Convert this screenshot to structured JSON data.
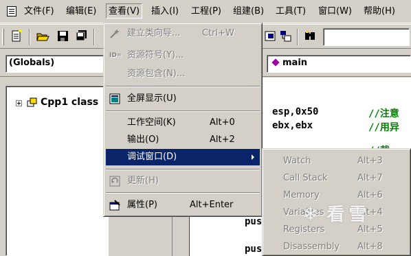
{
  "menubar": {
    "items": [
      {
        "label": "文件(F)"
      },
      {
        "label": "编辑(E)"
      },
      {
        "label": "查看(V)"
      },
      {
        "label": "插入(I)"
      },
      {
        "label": "工程(P)"
      },
      {
        "label": "组建(B)"
      },
      {
        "label": "工具(T)"
      },
      {
        "label": "窗口(W)"
      },
      {
        "label": "帮助(H)"
      }
    ]
  },
  "wizard": {
    "scope": "(Globals)",
    "function": "main"
  },
  "workspace": {
    "tree_root": "Cpp1 class"
  },
  "editor": {
    "lines": [
      {
        "code": "esp,0x50",
        "comment": "//注意"
      },
      {
        "code": "ebx,ebx",
        "comment": "//用异"
      },
      {
        "code": "",
        "comment": "//截"
      },
      {
        "code": "pus",
        "comment": ""
      },
      {
        "code": "pus",
        "comment": ""
      }
    ]
  },
  "view_menu": {
    "items": [
      {
        "label": "建立类向导...",
        "accel": "Ctrl+W",
        "disabled": true,
        "icon": "class-wizard-icon"
      },
      {
        "label": "资源符号(Y)...",
        "accel": "",
        "disabled": true,
        "icon": "resource-symbols-icon"
      },
      {
        "label": "资源包含(N)...",
        "accel": "",
        "disabled": true,
        "icon": ""
      },
      {
        "label": "全屏显示(U)",
        "accel": "",
        "disabled": false,
        "icon": "full-screen-icon"
      },
      {
        "label": "工作空间(K)",
        "accel": "Alt+0",
        "disabled": false,
        "icon": ""
      },
      {
        "label": "输出(O)",
        "accel": "Alt+2",
        "disabled": false,
        "icon": ""
      },
      {
        "label": "调试窗口(D)",
        "accel": "",
        "disabled": false,
        "icon": "",
        "selected": true
      },
      {
        "label": "更新(H)",
        "accel": "",
        "disabled": true,
        "icon": "refresh-icon"
      },
      {
        "label": "属性(P)",
        "accel": "Alt+Enter",
        "disabled": false,
        "icon": "properties-icon"
      }
    ]
  },
  "debug_submenu": {
    "items": [
      {
        "label": "Watch",
        "accel": "Alt+3"
      },
      {
        "label": "Call Stack",
        "accel": "Alt+7"
      },
      {
        "label": "Memory",
        "accel": "Alt+6"
      },
      {
        "label": "Variables",
        "accel": "Alt+4"
      },
      {
        "label": "Registers",
        "accel": "Alt+5"
      },
      {
        "label": "Disassembly",
        "accel": "Alt+8"
      }
    ]
  },
  "watermark": {
    "text": "看雪"
  },
  "colors": {
    "menu_highlight": "#0a246a",
    "face": "#d4d0c8",
    "comment": "#008000"
  }
}
